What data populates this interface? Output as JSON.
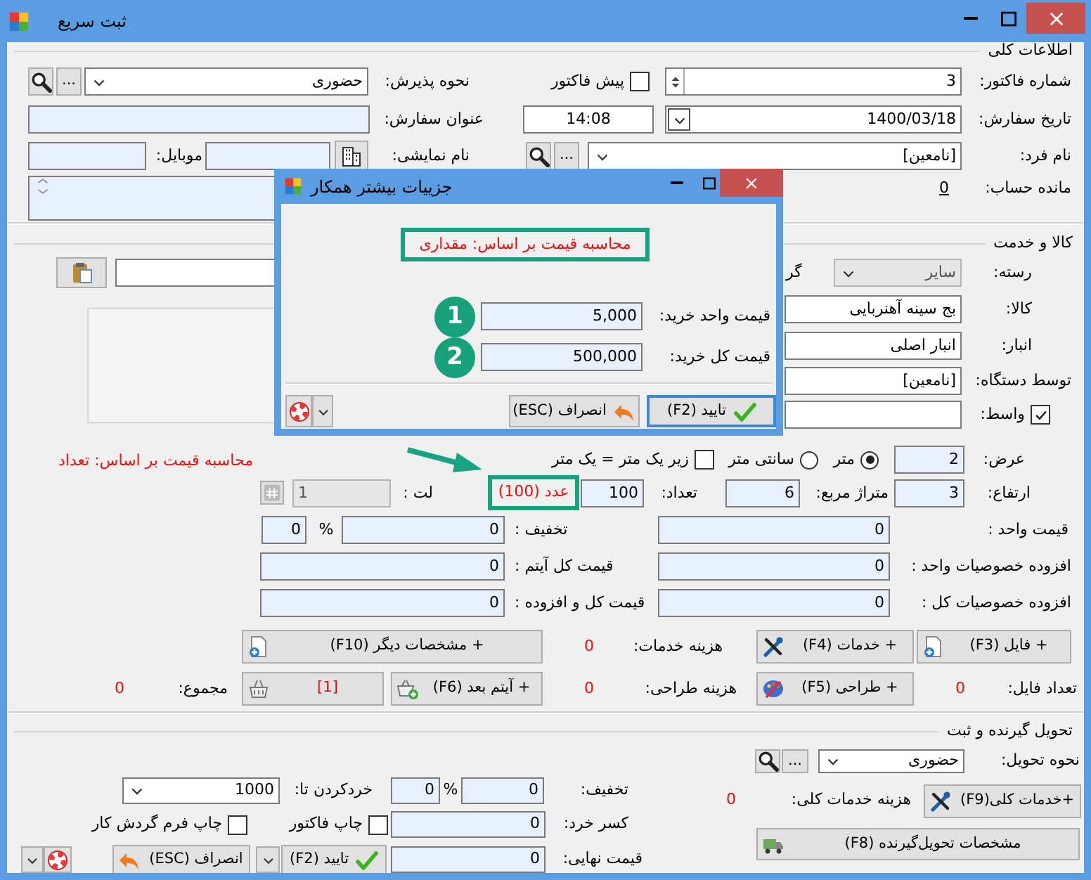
{
  "window": {
    "title": "ثبت سریع"
  },
  "sections": [
    {
      "title": "اطلاعات کلی",
      "lines": [
        {
          "right": [
            {
              "kind": "label",
              "text": "شماره فاکتور:"
            },
            {
              "kind": "spin",
              "value": "3"
            },
            {
              "kind": "check",
              "text": "پیش فاکتور",
              "checked": false
            }
          ],
          "left": [
            {
              "kind": "label",
              "text": "نحوه پذیرش:"
            },
            {
              "kind": "combo",
              "value": "حضوری"
            },
            {
              "kind": "button",
              "text": "..."
            },
            {
              "kind": "icon_button"
            }
          ]
        },
        {
          "right": [
            {
              "kind": "label",
              "text": "تاریخ سفارش:"
            },
            {
              "kind": "date",
              "value": "1400/03/18"
            },
            {
              "kind": "field",
              "value": "14:08"
            }
          ],
          "left": [
            {
              "kind": "label",
              "text": "عنوان سفارش:"
            },
            {
              "kind": "field"
            }
          ]
        },
        {
          "right": [
            {
              "kind": "label",
              "text": "نام فرد:"
            },
            {
              "kind": "combo",
              "value": "[نامعین]"
            },
            {
              "kind": "button",
              "text": "..."
            },
            {
              "kind": "icon_button"
            }
          ],
          "left": [
            {
              "kind": "label",
              "text": "نام نمایشی:"
            },
            {
              "kind": "icon_button"
            },
            {
              "kind": "field"
            },
            {
              "kind": "label",
              "text": "موبایل:"
            },
            {
              "kind": "field"
            }
          ]
        },
        {
          "right": [
            {
              "kind": "label",
              "text": "مانده حساب:"
            },
            {
              "kind": "link",
              "text": "0"
            }
          ],
          "left": [
            {
              "kind": "memo"
            }
          ]
        }
      ]
    },
    {
      "title": "کالا و خدمت",
      "basis_note": "محاسبه قیمت بر اساس: تعداد",
      "lines": [
        {
          "right": [
            {
              "kind": "label",
              "text": "رسته:"
            },
            {
              "kind": "combo",
              "value": "سایر"
            },
            {
              "kind": "label",
              "text": "گر"
            }
          ],
          "left": [
            {
              "kind": "field"
            },
            {
              "kind": "icon_button"
            }
          ]
        },
        {
          "right": [
            {
              "kind": "label",
              "text": "کالا:"
            },
            {
              "kind": "field",
              "value": "بج سینه آهنربایی"
            }
          ],
          "left": [
            {
              "kind": "panel"
            }
          ]
        },
        {
          "right": [
            {
              "kind": "label",
              "text": "انبار:"
            },
            {
              "kind": "field",
              "value": "انبار اصلی"
            }
          ]
        },
        {
          "right": [
            {
              "kind": "label",
              "text": "توسط دستگاه:"
            },
            {
              "kind": "field",
              "value": "[نامعین]"
            }
          ]
        },
        {
          "right": [
            {
              "kind": "check",
              "text": "واسط:",
              "checked": true
            },
            {
              "kind": "field"
            }
          ]
        },
        {
          "right": [
            {
              "kind": "label",
              "text": "عرض:"
            },
            {
              "kind": "field",
              "value": "2"
            },
            {
              "kind": "radio",
              "text": "متر",
              "selected": true
            },
            {
              "kind": "radio",
              "text": "سانتی متر",
              "selected": false
            },
            {
              "kind": "check",
              "text": "زیر یک متر = یک متر",
              "checked": false
            }
          ]
        },
        {
          "right": [
            {
              "kind": "label",
              "text": "ارتفاع:"
            },
            {
              "kind": "field",
              "value": "3"
            },
            {
              "kind": "label",
              "text": "متراژ مربع:"
            },
            {
              "kind": "field",
              "value": "6"
            },
            {
              "kind": "label",
              "text": "تعداد:"
            },
            {
              "kind": "field",
              "value": "100"
            }
          ],
          "left": [
            {
              "kind": "callout",
              "text": "عدد (100)"
            },
            {
              "kind": "label",
              "text": "لت :"
            },
            {
              "kind": "field",
              "value": "1",
              "disabled": true
            },
            {
              "kind": "icon_button"
            }
          ]
        },
        {
          "right": [
            {
              "kind": "label",
              "text": "قیمت واحد :"
            },
            {
              "kind": "field",
              "value": "0"
            }
          ],
          "left": [
            {
              "kind": "label",
              "text": "تخفیف :"
            },
            {
              "kind": "percent",
              "value": "0",
              "unit": "%",
              "percent": "0"
            }
          ]
        },
        {
          "right": [
            {
              "kind": "label",
              "text": "افزوده خصوصیات واحد :"
            },
            {
              "kind": "field",
              "value": "0"
            }
          ],
          "left": [
            {
              "kind": "label",
              "text": "قیمت کل آیتم :"
            },
            {
              "kind": "field",
              "value": "0"
            }
          ]
        },
        {
          "right": [
            {
              "kind": "label",
              "text": "افزوده خصوصیات کل :"
            },
            {
              "kind": "field",
              "value": "0"
            }
          ],
          "left": [
            {
              "kind": "label",
              "text": "قیمت کل و افزوده :"
            },
            {
              "kind": "field",
              "value": "0"
            }
          ]
        },
        {
          "right": [
            {
              "kind": "button",
              "text": "+ فایل (F3)"
            },
            {
              "kind": "button",
              "text": "+ خدمات (F4)"
            }
          ],
          "left": [
            {
              "kind": "label",
              "text": "هزینه خدمات:"
            },
            {
              "kind": "alert",
              "text": "0"
            },
            {
              "kind": "button",
              "text": "+ مشخصات دیگر (F10)"
            }
          ]
        },
        {
          "right": [
            {
              "kind": "label",
              "text": "تعداد فایل:"
            },
            {
              "kind": "alert",
              "text": "0"
            },
            {
              "kind": "button",
              "text": "+ طراحی (F5)"
            }
          ],
          "left": [
            {
              "kind": "label",
              "text": "هزینه طراحی:"
            },
            {
              "kind": "alert",
              "text": "0"
            },
            {
              "kind": "button",
              "text": "+ آیتم بعد (F6)"
            },
            {
              "kind": "alert_button",
              "text": "[1]"
            },
            {
              "kind": "label",
              "text": "مجموع:"
            },
            {
              "kind": "alert",
              "text": "0"
            }
          ]
        }
      ]
    },
    {
      "title": "تحویل گیرنده و ثبت",
      "lines": [
        {
          "right": [
            {
              "kind": "label",
              "text": "نحوه تحویل:"
            },
            {
              "kind": "combo",
              "value": "حضوری"
            },
            {
              "kind": "button",
              "text": "..."
            },
            {
              "kind": "icon_button"
            }
          ]
        },
        {
          "right": [
            {
              "kind": "button",
              "text": "+خدمات کلی(F9)"
            },
            {
              "kind": "label",
              "text": "هزینه خدمات کلی:"
            },
            {
              "kind": "alert",
              "text": "0"
            }
          ],
          "left": [
            {
              "kind": "label",
              "text": "تخفیف:"
            },
            {
              "kind": "percent",
              "value": "0",
              "unit": "%",
              "percent": "0"
            },
            {
              "kind": "label",
              "text": "خردکردن تا:"
            },
            {
              "kind": "combo",
              "value": "1000"
            }
          ]
        },
        {
          "right": [
            {
              "kind": "button",
              "text": "مشخصات تحویل‌گیرنده (F8)"
            }
          ],
          "left": [
            {
              "kind": "label",
              "text": "کسر خرد:"
            },
            {
              "kind": "field",
              "value": "0"
            },
            {
              "kind": "check",
              "text": "چاپ فاکتور",
              "checked": false
            },
            {
              "kind": "check",
              "text": "چاپ فرم گردش کار",
              "checked": false
            }
          ]
        },
        {
          "left": [
            {
              "kind": "label",
              "text": "قیمت نهایی:"
            },
            {
              "kind": "field",
              "value": "0"
            },
            {
              "kind": "button",
              "text": "تایید (F2)"
            },
            {
              "kind": "dropdown"
            },
            {
              "kind": "button",
              "text": "انصراف (ESC)"
            },
            {
              "kind": "icon_button"
            },
            {
              "kind": "dropdown"
            }
          ]
        }
      ]
    }
  ],
  "dialog": {
    "title": "جزییات بیشتر همکار",
    "basis": "محاسبه قیمت بر اساس: مقداری",
    "rows": [
      {
        "marker": "1",
        "label": "قیمت واحد خرید:",
        "value": "5,000"
      },
      {
        "marker": "2",
        "label": "قیمت کل خرید:",
        "value": "500,000"
      }
    ],
    "buttons": [
      {
        "kind": "ok",
        "text": "تایید (F2)"
      },
      {
        "kind": "cancel",
        "text": "انصراف (ESC)"
      },
      {
        "kind": "dropdown"
      },
      {
        "kind": "help"
      }
    ]
  }
}
